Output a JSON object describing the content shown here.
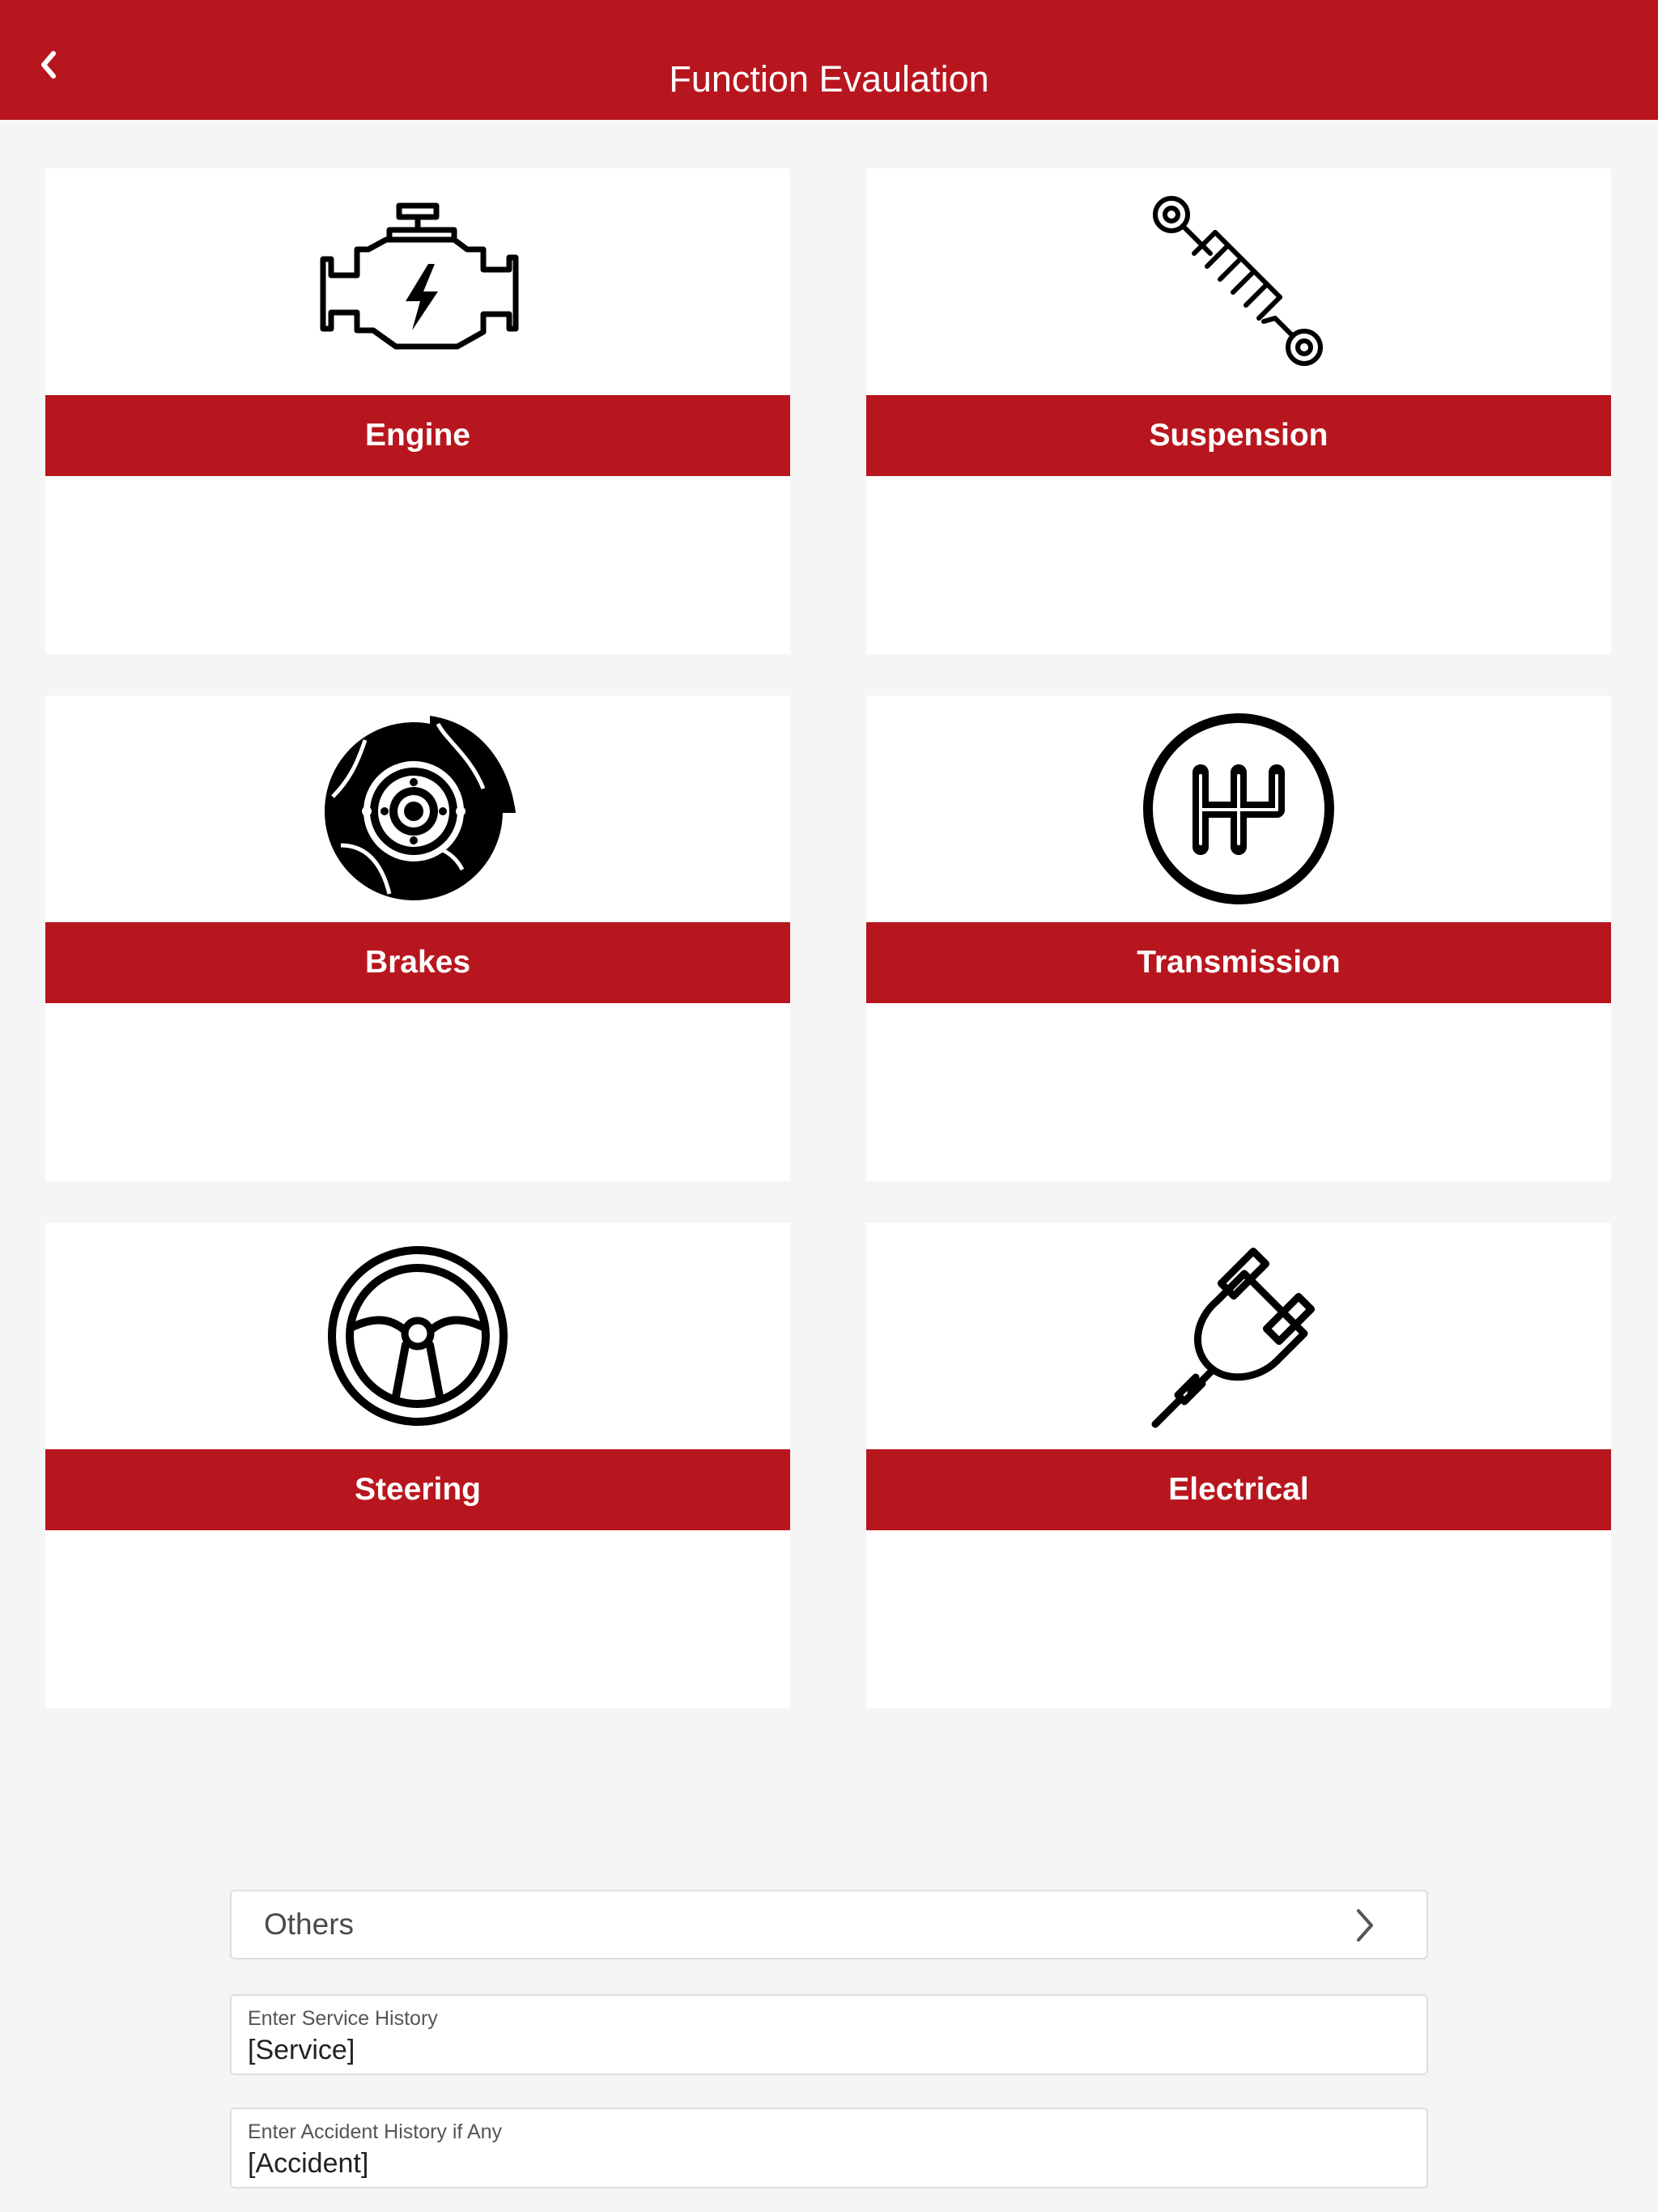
{
  "header": {
    "title": "Function Evaulation",
    "back_icon": "chevron-left-icon"
  },
  "cards": [
    {
      "label": "Engine",
      "icon": "engine-icon"
    },
    {
      "label": "Suspension",
      "icon": "suspension-icon"
    },
    {
      "label": "Brakes",
      "icon": "brake-disc-icon"
    },
    {
      "label": "Transmission",
      "icon": "gear-shift-icon"
    },
    {
      "label": "Steering",
      "icon": "steering-wheel-icon"
    },
    {
      "label": "Electrical",
      "icon": "plug-icon"
    }
  ],
  "others": {
    "label": "Others",
    "icon": "chevron-right-icon"
  },
  "fields": [
    {
      "label": "Enter Service History",
      "value": "[Service]"
    },
    {
      "label": "Enter Accident History if Any",
      "value": "[Accident]"
    }
  ],
  "colors": {
    "primary": "#b8161e",
    "background": "#f5f5f5",
    "card": "#ffffff"
  }
}
